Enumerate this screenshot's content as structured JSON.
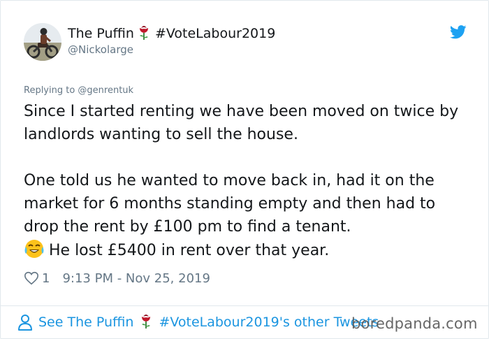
{
  "author": {
    "name": "The Puffin",
    "hashtag": "#VoteLabour2019",
    "handle": "@Nickolarge",
    "avatar_icon": "avatar-motorcyclist",
    "name_emoji_icon": "rose-icon"
  },
  "reply": {
    "text": "Replying to @genrentuk"
  },
  "tweet": {
    "paragraph1": "Since I started renting we have been moved on twice by landlords wanting to sell the house.",
    "paragraph2": "One told us he wanted to move back in, had it on the market for 6 months standing empty and then had to drop the rent by £100 pm to find a tenant.",
    "paragraph3": "He lost £5400 in rent over that year.",
    "paragraph3_emoji_icon": "face-with-tears-of-joy-icon"
  },
  "meta": {
    "likes": "1",
    "timestamp": "9:13 PM - Nov 25, 2019"
  },
  "footer": {
    "prefix": "See The Puffin",
    "suffix": "#VoteLabour2019's other Tweets"
  },
  "watermark": {
    "text": "boredpanda.com"
  },
  "colors": {
    "link_blue": "#1b95e0",
    "twitter_blue": "#1da1f2",
    "muted_gray": "#657786",
    "text": "#14171a",
    "rose_red": "#c0182b"
  }
}
